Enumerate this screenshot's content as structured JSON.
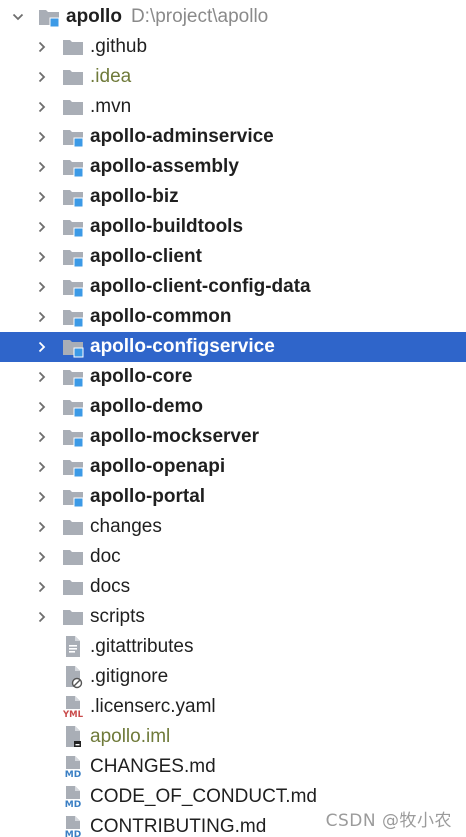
{
  "root": {
    "name": "apollo",
    "path": "D:\\project\\apollo"
  },
  "items": [
    {
      "label": ".github",
      "kind": "folder",
      "bold": false,
      "selected": false,
      "muted": false
    },
    {
      "label": ".idea",
      "kind": "folder",
      "bold": false,
      "selected": false,
      "muted": true
    },
    {
      "label": ".mvn",
      "kind": "folder",
      "bold": false,
      "selected": false,
      "muted": false
    },
    {
      "label": "apollo-adminservice",
      "kind": "module",
      "bold": true,
      "selected": false,
      "muted": false
    },
    {
      "label": "apollo-assembly",
      "kind": "module",
      "bold": true,
      "selected": false,
      "muted": false
    },
    {
      "label": "apollo-biz",
      "kind": "module",
      "bold": true,
      "selected": false,
      "muted": false
    },
    {
      "label": "apollo-buildtools",
      "kind": "module",
      "bold": true,
      "selected": false,
      "muted": false
    },
    {
      "label": "apollo-client",
      "kind": "module",
      "bold": true,
      "selected": false,
      "muted": false
    },
    {
      "label": "apollo-client-config-data",
      "kind": "module",
      "bold": true,
      "selected": false,
      "muted": false
    },
    {
      "label": "apollo-common",
      "kind": "module",
      "bold": true,
      "selected": false,
      "muted": false
    },
    {
      "label": "apollo-configservice",
      "kind": "module",
      "bold": true,
      "selected": true,
      "muted": false
    },
    {
      "label": "apollo-core",
      "kind": "module",
      "bold": true,
      "selected": false,
      "muted": false
    },
    {
      "label": "apollo-demo",
      "kind": "module",
      "bold": true,
      "selected": false,
      "muted": false
    },
    {
      "label": "apollo-mockserver",
      "kind": "module",
      "bold": true,
      "selected": false,
      "muted": false
    },
    {
      "label": "apollo-openapi",
      "kind": "module",
      "bold": true,
      "selected": false,
      "muted": false
    },
    {
      "label": "apollo-portal",
      "kind": "module",
      "bold": true,
      "selected": false,
      "muted": false
    },
    {
      "label": "changes",
      "kind": "folder",
      "bold": false,
      "selected": false,
      "muted": false
    },
    {
      "label": "doc",
      "kind": "folder",
      "bold": false,
      "selected": false,
      "muted": false
    },
    {
      "label": "docs",
      "kind": "folder",
      "bold": false,
      "selected": false,
      "muted": false
    },
    {
      "label": "scripts",
      "kind": "folder",
      "bold": false,
      "selected": false,
      "muted": false
    },
    {
      "label": ".gitattributes",
      "kind": "text-file",
      "bold": false,
      "selected": false,
      "muted": false
    },
    {
      "label": ".gitignore",
      "kind": "ignore-file",
      "bold": false,
      "selected": false,
      "muted": false
    },
    {
      "label": ".licenserc.yaml",
      "kind": "yaml-file",
      "bold": false,
      "selected": false,
      "muted": false
    },
    {
      "label": "apollo.iml",
      "kind": "iml-file",
      "bold": false,
      "selected": false,
      "muted": true
    },
    {
      "label": "CHANGES.md",
      "kind": "md-file",
      "bold": false,
      "selected": false,
      "muted": false
    },
    {
      "label": "CODE_OF_CONDUCT.md",
      "kind": "md-file",
      "bold": false,
      "selected": false,
      "muted": false
    },
    {
      "label": "CONTRIBUTING.md",
      "kind": "md-file",
      "bold": false,
      "selected": false,
      "muted": false
    }
  ],
  "watermark": "CSDN @牧小农",
  "colors": {
    "selection": "#2f65ca",
    "folder": "#a9aeb6",
    "module_badge": "#3c9ae6",
    "muted_text": "#6f7a3a",
    "root_path": "#8a8a8a"
  }
}
